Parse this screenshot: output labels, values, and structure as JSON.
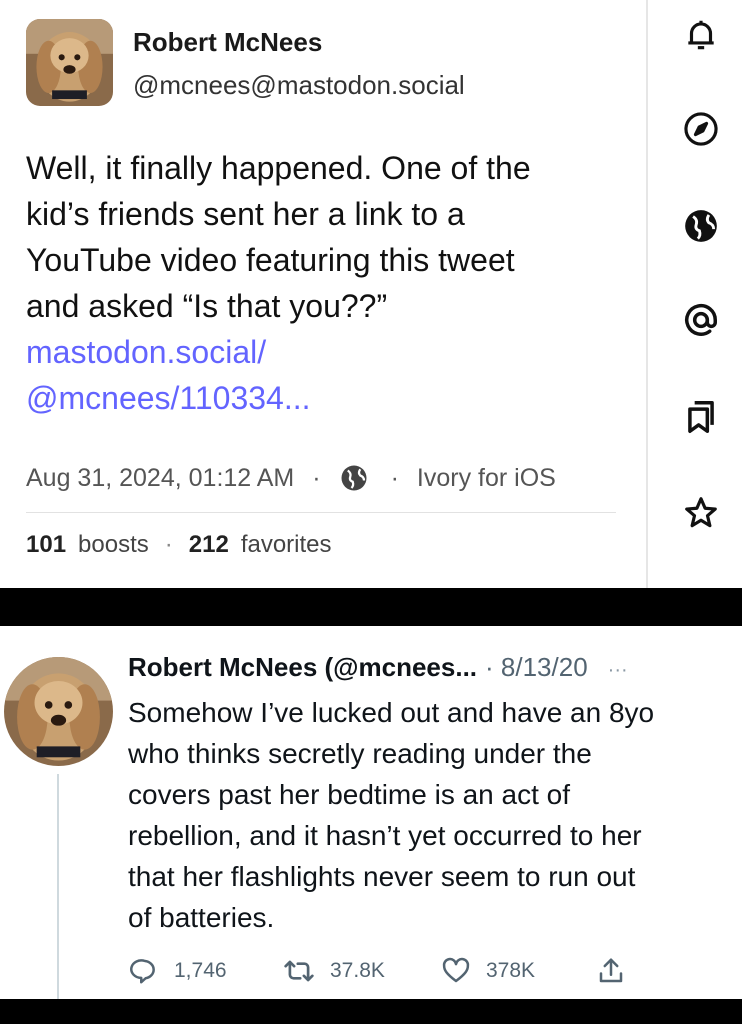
{
  "mastodon_post": {
    "author_name": "Robert McNees",
    "handle": "@mcnees@mastodon.social",
    "body_lines": [
      "Well, it finally happened. One of the",
      "kid’s friends sent her a link to a",
      "YouTube video featuring this tweet",
      "and asked “Is that you??”"
    ],
    "link_lines": [
      "mastodon.social/",
      "@mcnees/110334..."
    ],
    "date": "Aug 31, 2024, 01:12 AM",
    "separator": "·",
    "visibility_icon": "globe-icon",
    "client": "Ivory for iOS",
    "boosts_count": "101",
    "boosts_label": "boosts",
    "favorites_count": "212",
    "favorites_label": "favorites"
  },
  "sidebar": {
    "icons": [
      "bell-icon",
      "compass-icon",
      "globe-icon",
      "at-icon",
      "bookmarks-icon",
      "star-icon"
    ]
  },
  "tweet": {
    "header": "Robert McNees (@mcnees...",
    "date": "· 8/13/20",
    "more": "···",
    "body_lines": [
      "Somehow I’ve lucked out and have an 8yo",
      "who thinks secretly reading under the",
      "covers past her bedtime is an act of",
      "rebellion, and it hasn’t yet occurred to her",
      "that her flashlights never seem to run out",
      "of batteries."
    ],
    "replies": "1,746",
    "retweets": "37.8K",
    "likes": "378K"
  }
}
